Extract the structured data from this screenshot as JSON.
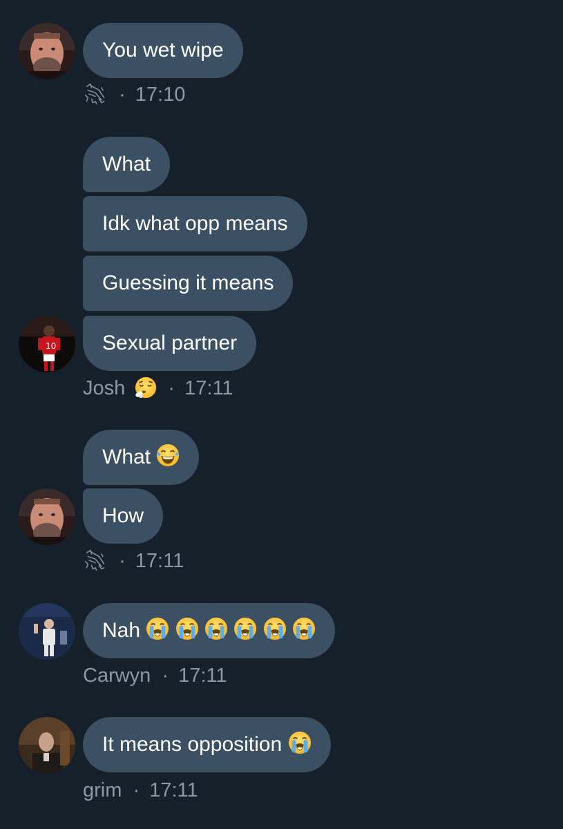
{
  "groups": [
    {
      "messages": [
        "You wet wipe"
      ],
      "sender_name": "",
      "time": "17:10"
    },
    {
      "messages": [
        "What",
        "Idk what opp means",
        "Guessing it means",
        "Sexual partner"
      ],
      "sender_name": "Josh",
      "time": "17:11"
    },
    {
      "messages": [
        "What",
        "How"
      ],
      "sender_name": "",
      "time": "17:11"
    },
    {
      "messages": [
        "Nah"
      ],
      "sender_name": "Carwyn",
      "time": "17:11"
    },
    {
      "messages": [
        "It means opposition"
      ],
      "sender_name": "grim",
      "time": "17:11"
    }
  ],
  "separator": "·",
  "icons": {
    "loudly_crying": "loudly-crying-face-emoji",
    "tears_of_joy": "face-with-tears-of-joy-emoji",
    "exhale": "face-exhaling-emoji",
    "name_badge": "fox-logo-icon"
  },
  "colors": {
    "background": "#15202b",
    "bubble": "#3b5063",
    "meta_text": "#8b98a5"
  }
}
